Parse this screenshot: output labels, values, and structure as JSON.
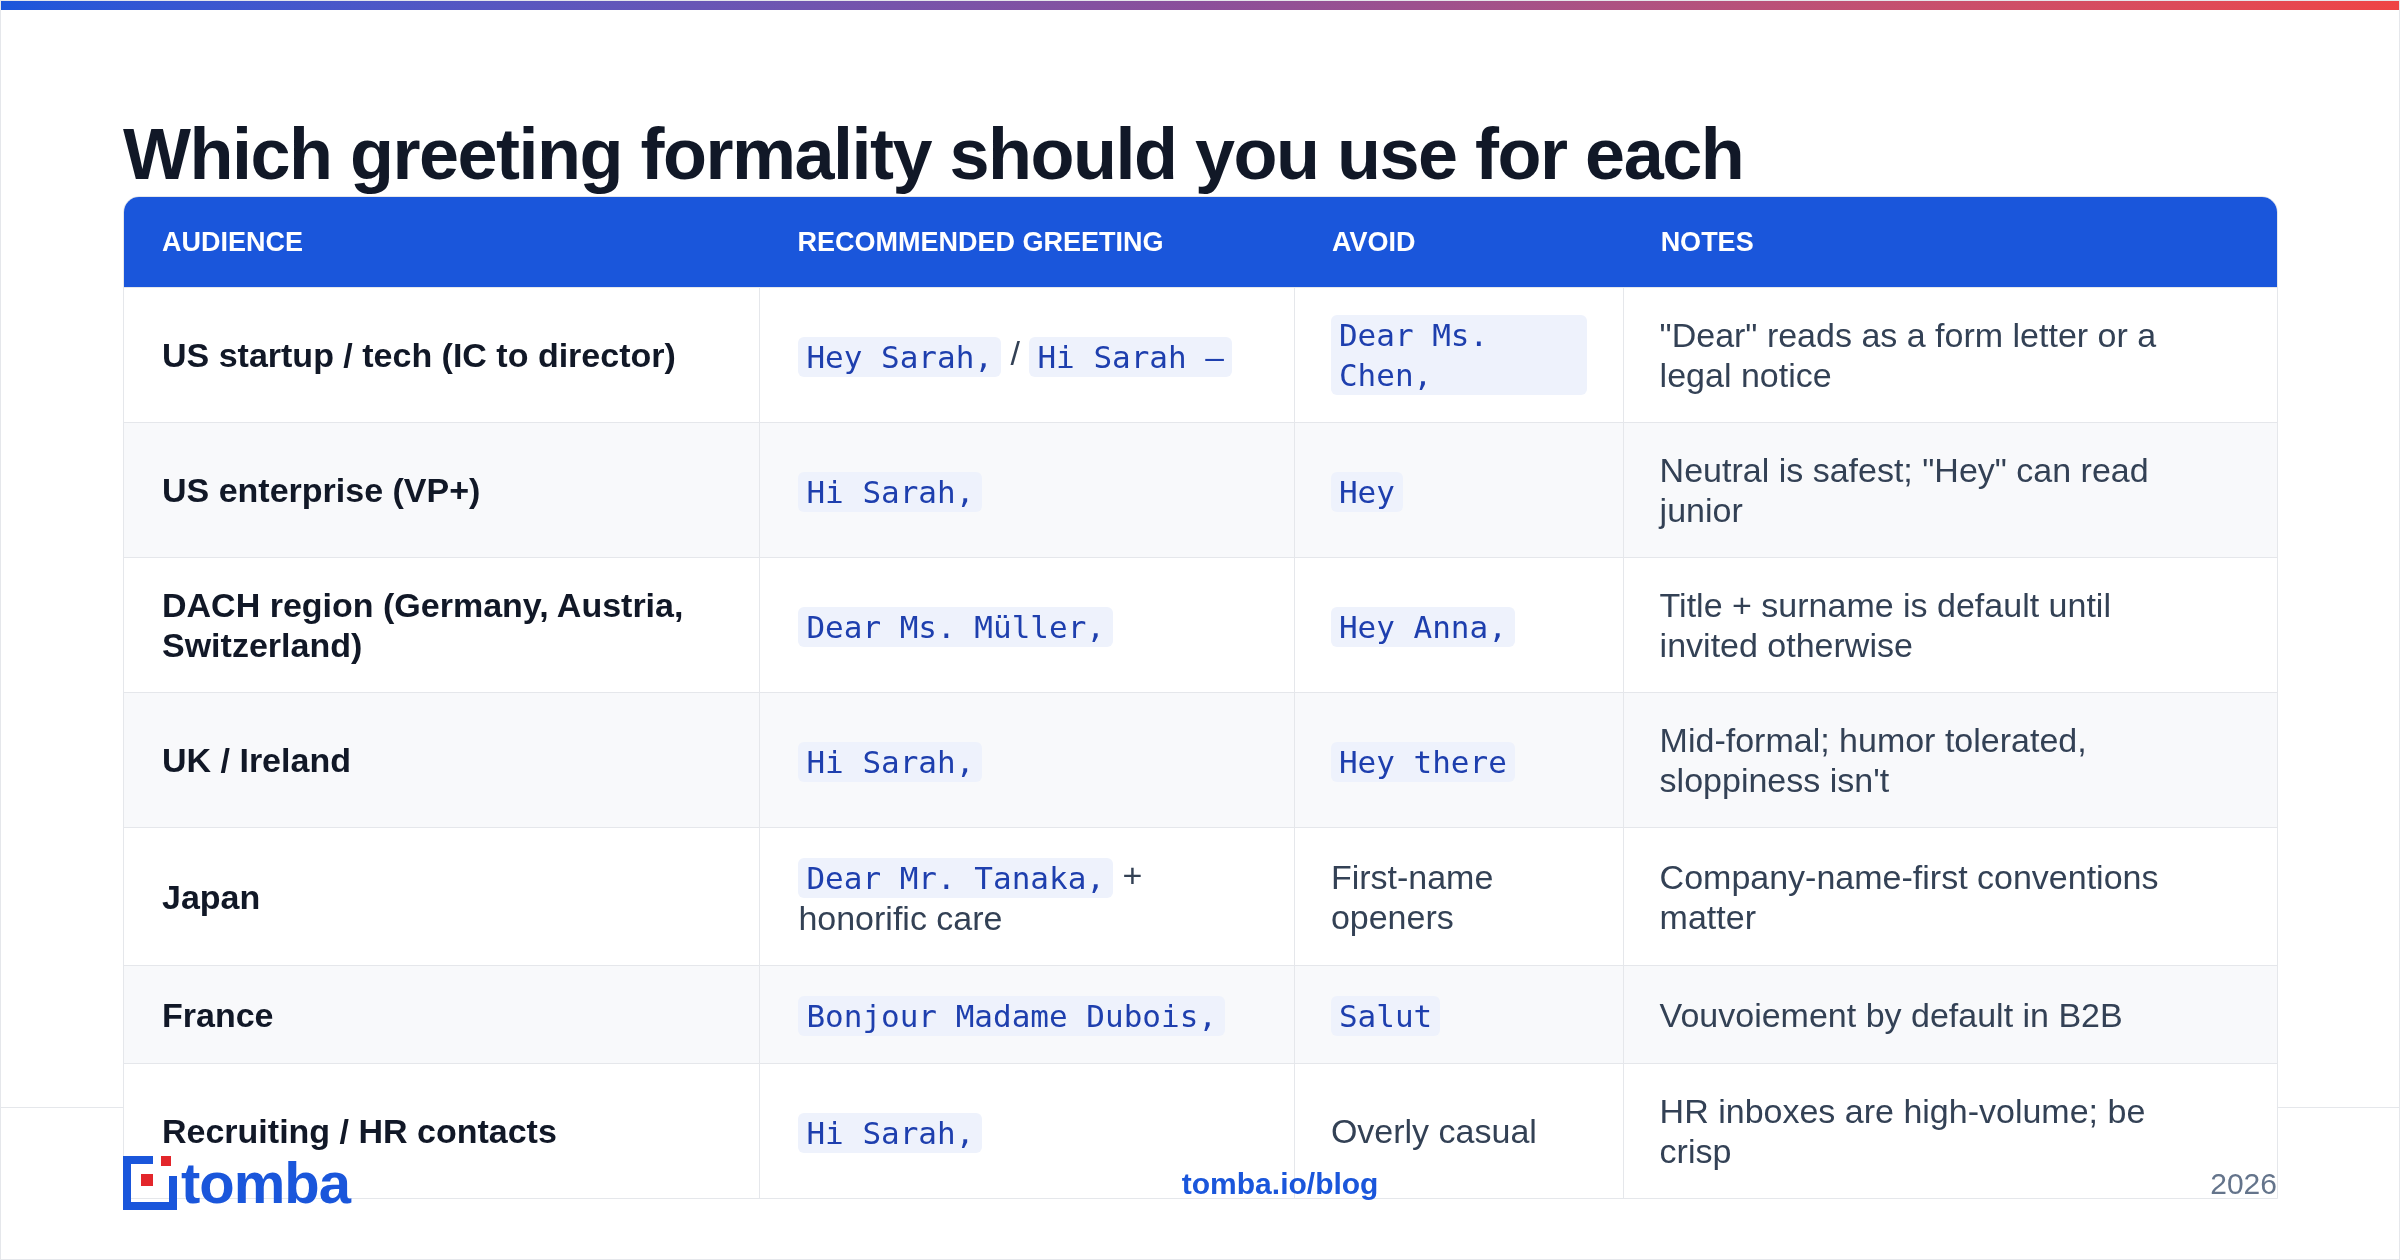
{
  "title": "Which greeting formality should you use for each",
  "table": {
    "columns": [
      "AUDIENCE",
      "RECOMMENDED GREETING",
      "AVOID",
      "NOTES"
    ],
    "rows": [
      {
        "audience": "US startup / tech (IC to director)",
        "greeting": [
          {
            "kind": "code",
            "text": "Hey Sarah,"
          },
          {
            "kind": "text",
            "text": "/"
          },
          {
            "kind": "code",
            "text": "Hi Sarah —"
          }
        ],
        "avoid": [
          {
            "kind": "code",
            "text": "Dear Ms. Chen,"
          }
        ],
        "notes": "\"Dear\" reads as a form letter or a legal notice"
      },
      {
        "audience": "US enterprise (VP+)",
        "greeting": [
          {
            "kind": "code",
            "text": "Hi Sarah,"
          }
        ],
        "avoid": [
          {
            "kind": "code",
            "text": "Hey"
          }
        ],
        "notes": "Neutral is safest; \"Hey\" can read junior"
      },
      {
        "audience": "DACH region (Germany, Austria, Switzerland)",
        "greeting": [
          {
            "kind": "code",
            "text": "Dear Ms. Müller,"
          }
        ],
        "avoid": [
          {
            "kind": "code",
            "text": "Hey Anna,"
          }
        ],
        "notes": "Title + surname is default until invited otherwise"
      },
      {
        "audience": "UK / Ireland",
        "greeting": [
          {
            "kind": "code",
            "text": "Hi Sarah,"
          }
        ],
        "avoid": [
          {
            "kind": "code",
            "text": "Hey there"
          }
        ],
        "notes": "Mid-formal; humor tolerated, sloppiness isn't"
      },
      {
        "audience": "Japan",
        "greeting": [
          {
            "kind": "code",
            "text": "Dear Mr. Tanaka,"
          },
          {
            "kind": "text",
            "text": "+"
          },
          {
            "kind": "text",
            "text": "honorific care"
          }
        ],
        "avoid": [
          {
            "kind": "text",
            "text": "First-name openers"
          }
        ],
        "notes": "Company-name-first conventions matter"
      },
      {
        "audience": "France",
        "greeting": [
          {
            "kind": "code",
            "text": "Bonjour Madame Dubois,"
          }
        ],
        "avoid": [
          {
            "kind": "code",
            "text": "Salut"
          }
        ],
        "notes": "Vouvoiement by default in B2B"
      },
      {
        "audience": "Recruiting / HR contacts",
        "greeting": [
          {
            "kind": "code",
            "text": "Hi Sarah,"
          }
        ],
        "avoid": [
          {
            "kind": "text",
            "text": "Overly casual"
          }
        ],
        "notes": "HR inboxes are high-volume; be crisp"
      }
    ]
  },
  "footer": {
    "logo": "tomba",
    "link": "tomba.io/blog",
    "year": "2026"
  }
}
